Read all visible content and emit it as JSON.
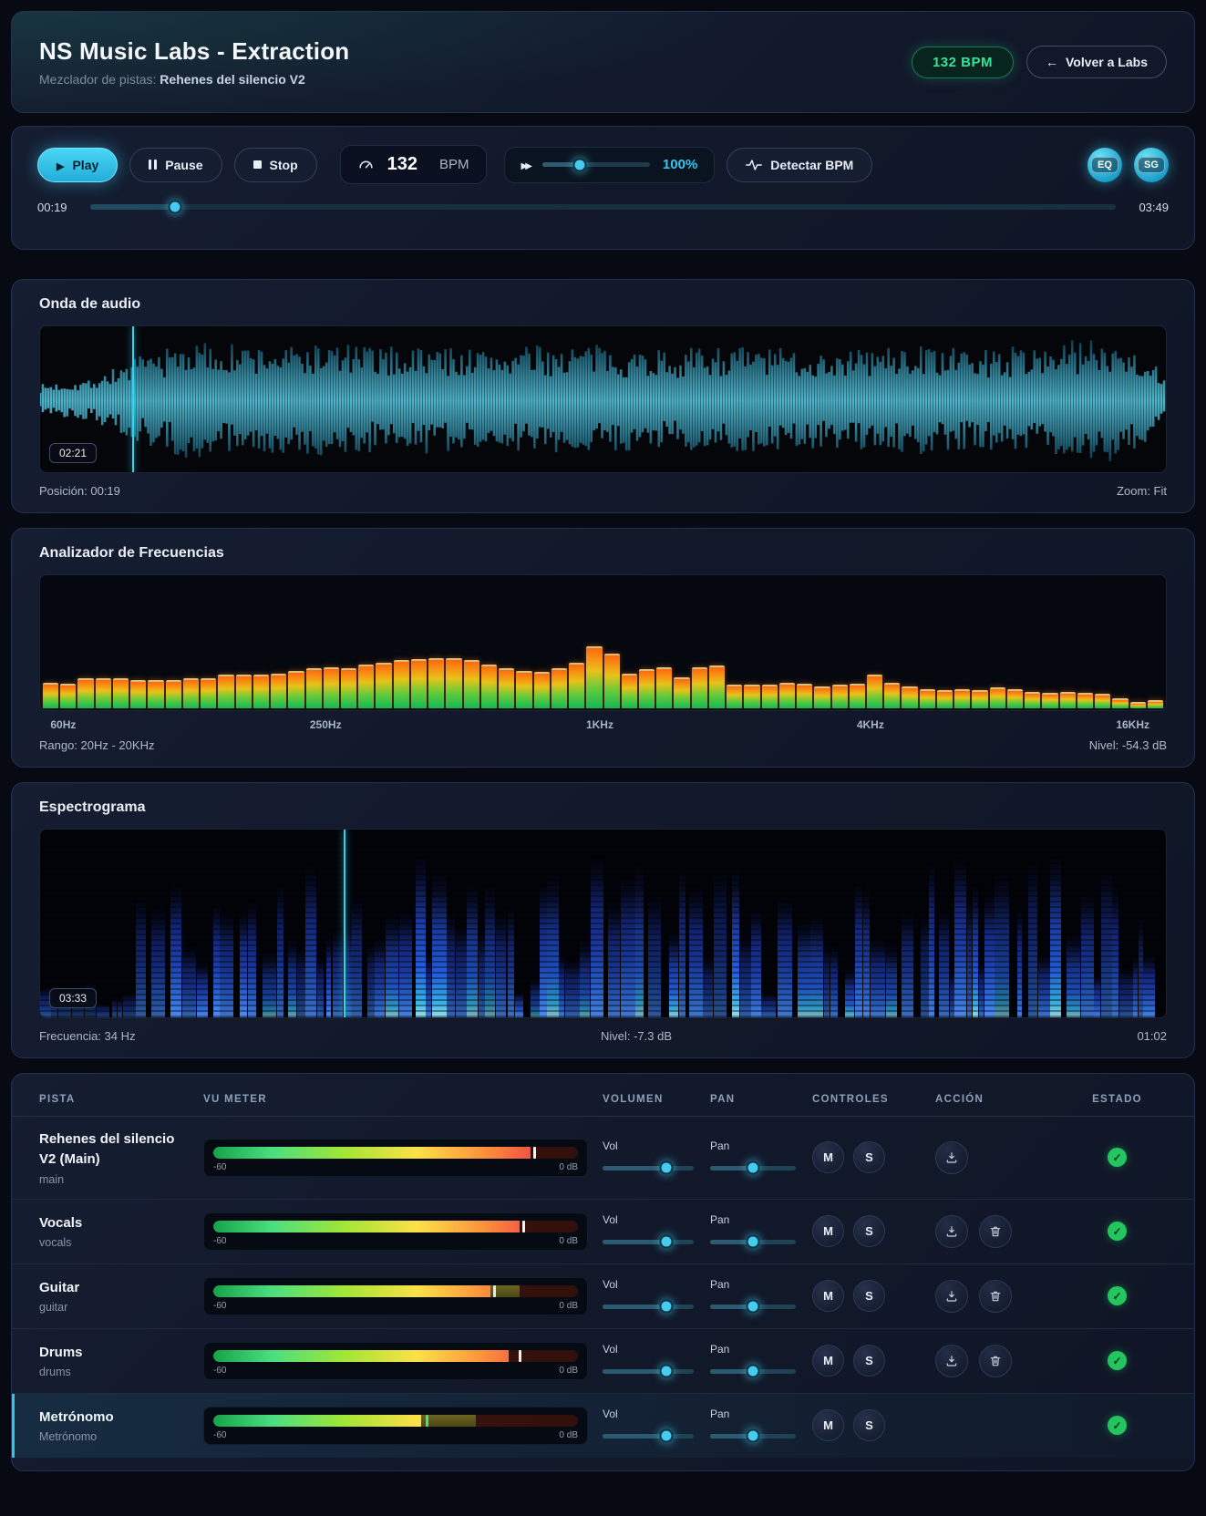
{
  "header": {
    "title": "NS Music Labs - Extraction",
    "subtitle_label": "Mezclador de pistas:",
    "subtitle_track": "Rehenes del silencio V2",
    "bpm_badge": "132 BPM",
    "back_label": "Volver a Labs"
  },
  "transport": {
    "play": "Play",
    "pause": "Pause",
    "stop": "Stop",
    "bpm_value": "132",
    "bpm_unit": "BPM",
    "speed_label": "100%",
    "speed_pct": 35,
    "detect": "Detectar BPM",
    "eq": "EQ",
    "sg": "SG",
    "time_current": "00:19",
    "time_total": "03:49",
    "progress_pct": 8.3
  },
  "waveform": {
    "title": "Onda de audio",
    "time_badge": "02:21",
    "position_label": "Posición: 00:19",
    "zoom_label": "Zoom: Fit",
    "playhead_pct": 8.2,
    "envelope": [
      22,
      30,
      62,
      85,
      80,
      78,
      83,
      76,
      79,
      74,
      77,
      81,
      75,
      73,
      79,
      75,
      71,
      75,
      79,
      73,
      77,
      85,
      92,
      40
    ]
  },
  "analyzer": {
    "title": "Analizador de Frecuencias",
    "freq_labels": [
      "60Hz",
      "250Hz",
      "1KHz",
      "4KHz",
      "16KHz"
    ],
    "freq_label_pos": [
      1,
      24,
      48.5,
      72.5,
      95.5
    ],
    "range_label": "Rango: 20Hz - 20KHz",
    "level_label": "Nivel: -54.3 dB",
    "bars": [
      20,
      19,
      23,
      23,
      23,
      22,
      22,
      22,
      23,
      23,
      26,
      26,
      26,
      27,
      29,
      31,
      32,
      31,
      34,
      35,
      37,
      38,
      39,
      39,
      37,
      34,
      31,
      29,
      28,
      31,
      35,
      48,
      42,
      27,
      30,
      32,
      24,
      32,
      33,
      18,
      18,
      18,
      20,
      19,
      17,
      18,
      19,
      26,
      20,
      17,
      15,
      14,
      15,
      14,
      16,
      15,
      13,
      12,
      13,
      12,
      11,
      8,
      5,
      6
    ]
  },
  "spectrogram": {
    "title": "Espectrograma",
    "time_badge": "03:33",
    "freq_label": "Frecuencia: 34 Hz",
    "level_label": "Nivel: -7.3 dB",
    "time_right": "01:02",
    "playhead_pct": 27
  },
  "mixer": {
    "columns": [
      "PISTA",
      "VU METER",
      "VOLUMEN",
      "PAN",
      "CONTROLES",
      "ACCIÓN",
      "ESTADO"
    ],
    "vol_label": "Vol",
    "pan_label": "Pan",
    "mute_label": "M",
    "solo_label": "S",
    "vu_min_label": "-60",
    "vu_max_label": "0 dB",
    "tracks": [
      {
        "name": "Rehenes del silencio V2 (Main)",
        "sub": "main",
        "vu": {
          "level": 87,
          "peak": 88,
          "hold": 0,
          "peak_color": "#f1f5f9"
        },
        "vol_pct": 70,
        "pan_pct": 50,
        "actions": [
          "download"
        ],
        "status": "check",
        "highlight": false
      },
      {
        "name": "Vocals",
        "sub": "vocals",
        "vu": {
          "level": 84,
          "peak": 85,
          "hold": 0,
          "peak_color": "#f1f5f9"
        },
        "vol_pct": 70,
        "pan_pct": 50,
        "actions": [
          "download",
          "trash"
        ],
        "status": "check",
        "highlight": false
      },
      {
        "name": "Guitar",
        "sub": "guitar",
        "vu": {
          "level": 76,
          "peak": 77,
          "hold": 84,
          "peak_color": "#e2e8f0"
        },
        "vol_pct": 70,
        "pan_pct": 50,
        "actions": [
          "download",
          "trash"
        ],
        "status": "check",
        "highlight": false
      },
      {
        "name": "Drums",
        "sub": "drums",
        "vu": {
          "level": 81,
          "peak": 84,
          "hold": 0,
          "peak_color": "#f1f5f9"
        },
        "vol_pct": 70,
        "pan_pct": 50,
        "actions": [
          "download",
          "trash"
        ],
        "status": "check",
        "highlight": false
      },
      {
        "name": "Metrónomo",
        "sub": "Metrónomo",
        "vu": {
          "level": 57,
          "peak": 58.5,
          "hold": 72,
          "peak_color": "#4ade80"
        },
        "vol_pct": 70,
        "pan_pct": 50,
        "actions": [],
        "status": "check",
        "highlight": true
      }
    ]
  }
}
